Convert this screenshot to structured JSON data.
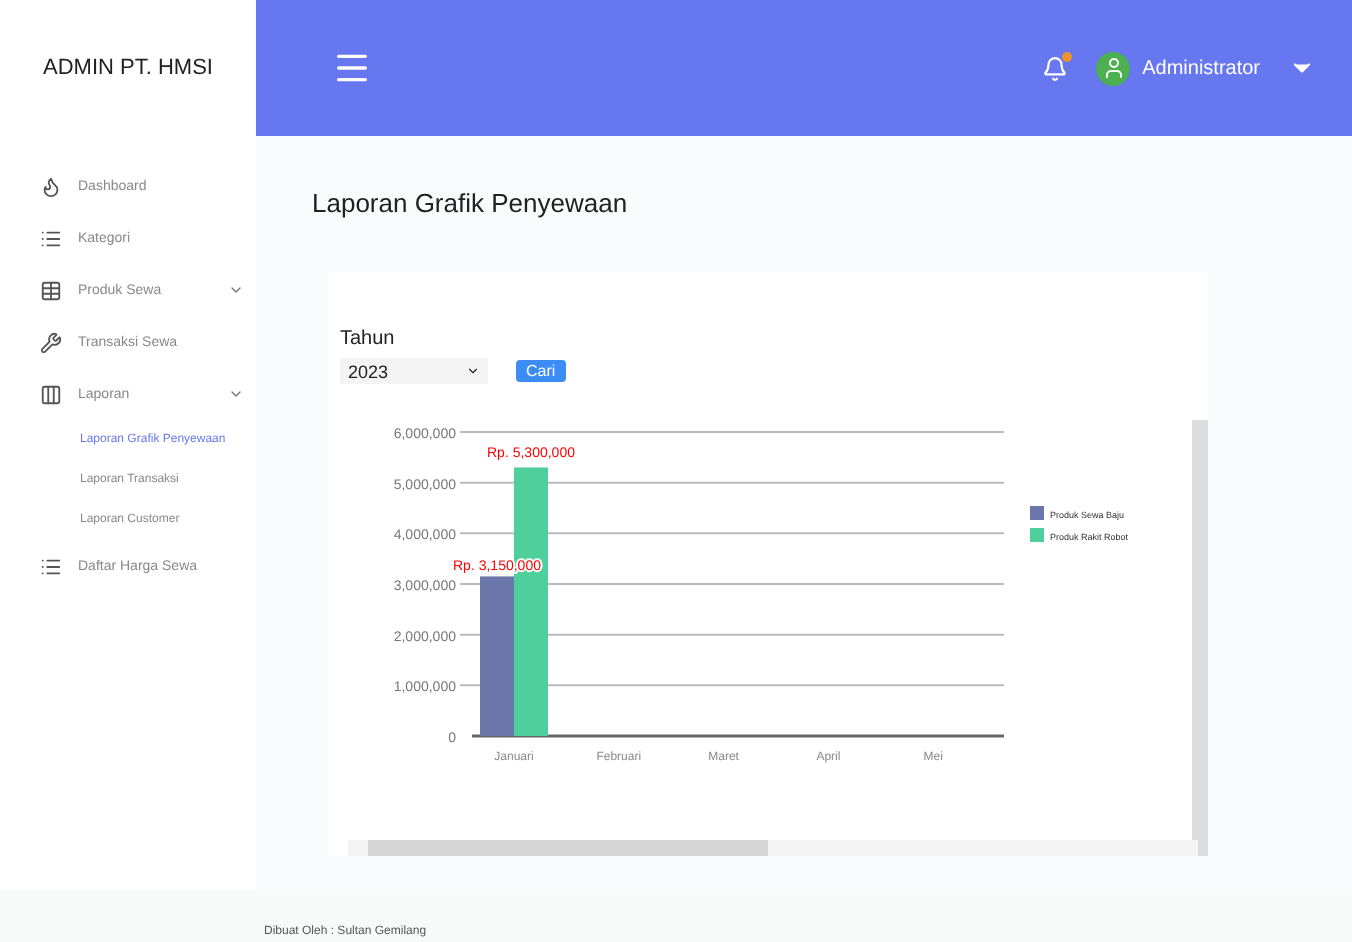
{
  "brand": "ADMIN PT. HMSI",
  "header": {
    "user": "Administrator",
    "has_notification": true
  },
  "sidebar": {
    "items": [
      {
        "label": "Dashboard",
        "caret": false,
        "selected": false
      },
      {
        "label": "Kategori",
        "caret": false,
        "selected": false
      },
      {
        "label": "Produk Sewa",
        "caret": true,
        "selected": false
      },
      {
        "label": "Transaksi Sewa",
        "caret": false,
        "selected": false
      },
      {
        "label": "Laporan",
        "caret": true,
        "selected": false,
        "children": [
          {
            "label": "Laporan Grafik Penyewaan",
            "selected": true
          },
          {
            "label": "Laporan Transaksi",
            "selected": false
          },
          {
            "label": "Laporan Customer",
            "selected": false
          }
        ]
      },
      {
        "label": "Daftar Harga Sewa",
        "caret": false,
        "selected": false
      }
    ]
  },
  "page_title": "Laporan Grafik Penyewaan",
  "filter": {
    "label": "Tahun",
    "value": "2023",
    "button": "Cari"
  },
  "chart": {
    "chart_data": {
      "type": "bar",
      "categories": [
        "Januari",
        "Februari",
        "Maret",
        "April",
        "Mei"
      ],
      "series": [
        {
          "name": "Produk Sewa Baju",
          "color": "#6b77ab",
          "values": [
            3150000,
            null,
            null,
            null,
            null
          ]
        },
        {
          "name": "Produk Rakit Robot",
          "color": "#4fcf9b",
          "values": [
            5300000,
            null,
            null,
            null,
            null
          ]
        }
      ],
      "ylim": [
        0,
        6000000
      ],
      "grid": true,
      "legend": true,
      "yticks": [
        {
          "value": 0,
          "label": "0"
        },
        {
          "value": 1000000,
          "label": "1,000,000"
        },
        {
          "value": 2000000,
          "label": "2,000,000"
        },
        {
          "value": 3000000,
          "label": "3,000,000"
        },
        {
          "value": 4000000,
          "label": "4,000,000"
        },
        {
          "value": 5000000,
          "label": "5,000,000"
        },
        {
          "value": 6000000,
          "label": "6,000,000"
        }
      ],
      "value_labels": [
        "Rp. 3,150,000",
        "Rp. 5,300,000"
      ]
    }
  },
  "footer": "Dibuat Oleh : Sultan Gemilang"
}
